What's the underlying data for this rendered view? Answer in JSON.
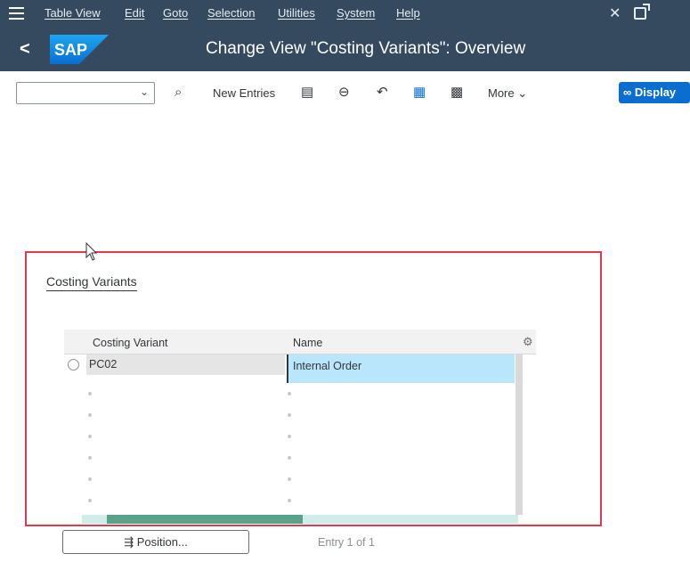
{
  "menu": {
    "items": [
      "Table View",
      "Edit",
      "Goto",
      "Selection",
      "Utilities",
      "System",
      "Help"
    ]
  },
  "header": {
    "title": "Change View \"Costing Variants\": Overview",
    "logo_text": "SAP"
  },
  "toolbar": {
    "new_entries_label": "New Entries",
    "more_label": "More",
    "display_label": "Display"
  },
  "panel": {
    "title": "Costing Variants",
    "columns": [
      "Costing Variant",
      "Name"
    ],
    "rows": [
      {
        "costing_variant": "PC02",
        "name": "Internal Order"
      }
    ]
  },
  "footer": {
    "position_label": "Position...",
    "entry_info": "Entry 1 of 1"
  },
  "colors": {
    "shell": "#354a5f",
    "accent": "#0a6ed1",
    "highlight": "#b9e6fa",
    "panel_border": "#e03a4e"
  }
}
